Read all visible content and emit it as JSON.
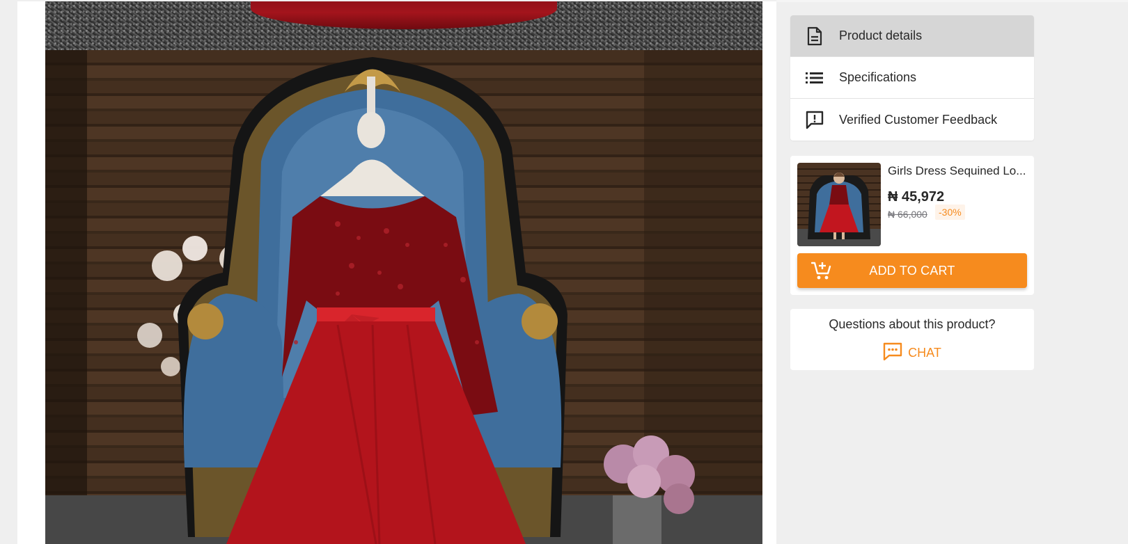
{
  "nav": {
    "items": [
      {
        "label": "Product details",
        "icon": "document-icon",
        "active": true
      },
      {
        "label": "Specifications",
        "icon": "list-icon",
        "active": false
      },
      {
        "label": "Verified Customer Feedback",
        "icon": "feedback-icon",
        "active": false
      }
    ]
  },
  "product": {
    "name": "Girls Dress Sequined Lo...",
    "price": "₦ 45,972",
    "old_price": "₦ 66,000",
    "discount": "-30%",
    "add_to_cart_label": "ADD TO CART"
  },
  "questions": {
    "text": "Questions about this product?",
    "chat_label": "CHAT"
  },
  "colors": {
    "accent": "#f68b1e",
    "active_nav_bg": "#d6d6d6",
    "page_bg": "#efefef",
    "dress_red": "#a3141c",
    "chair_blue": "#3f6e9c"
  }
}
